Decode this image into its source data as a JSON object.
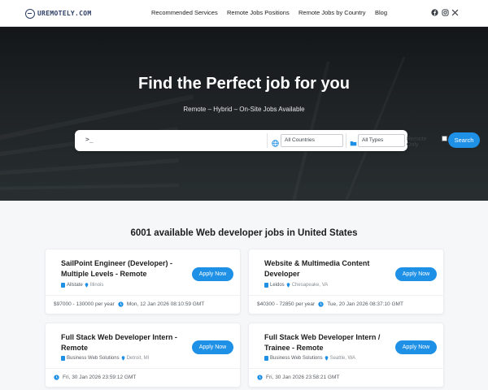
{
  "header": {
    "logo_text": "UREMOTELY.COM",
    "nav": [
      "Recommended Services",
      "Remote Jobs Positions",
      "Remote Jobs by Country",
      "Blog"
    ],
    "social_icons": [
      "facebook-icon",
      "instagram-icon",
      "x-icon"
    ]
  },
  "hero": {
    "title": "Find the Perfect job for you",
    "subtitle": "Remote – Hybrid – On-Site Jobs Available",
    "search": {
      "keyword_placeholder": "",
      "country_value": "All Countries",
      "type_value": "All Types",
      "remote_label": "Remote Only",
      "remote_checked": false,
      "button_label": "Search"
    }
  },
  "results": {
    "title": "6001 available Web developer jobs in United States",
    "apply_label": "Apply Now",
    "jobs": [
      {
        "title": "SailPoint Engineer (Developer) - Multiple Levels - Remote",
        "company": "Allstate",
        "location": "Illinois",
        "salary": "$97000 - 130000 per year",
        "date": "Mon, 12 Jan 2026 08:10:59 GMT"
      },
      {
        "title": "Website & Multimedia Content Developer",
        "company": "Leidos",
        "location": "Chesapeake, VA",
        "salary": "$40300 - 72850 per year",
        "date": "Tue, 20 Jan 2026 08:37:10 GMT"
      },
      {
        "title": "Full Stack Web Developer Intern - Remote",
        "company": "Business Web Solutions",
        "location": "Detroit, MI",
        "salary": "",
        "date": "Fri, 30 Jan 2026 23:59:12 GMT"
      },
      {
        "title": "Full Stack Web Developer Intern / Trainee - Remote",
        "company": "Business Web Solutions",
        "location": "Seattle, WA",
        "salary": "",
        "date": "Fri, 30 Jan 2026 23:58:21 GMT"
      }
    ]
  },
  "colors": {
    "accent": "#1e90e6",
    "logo": "#2d3e66",
    "hero_bg": "#2b3033"
  }
}
